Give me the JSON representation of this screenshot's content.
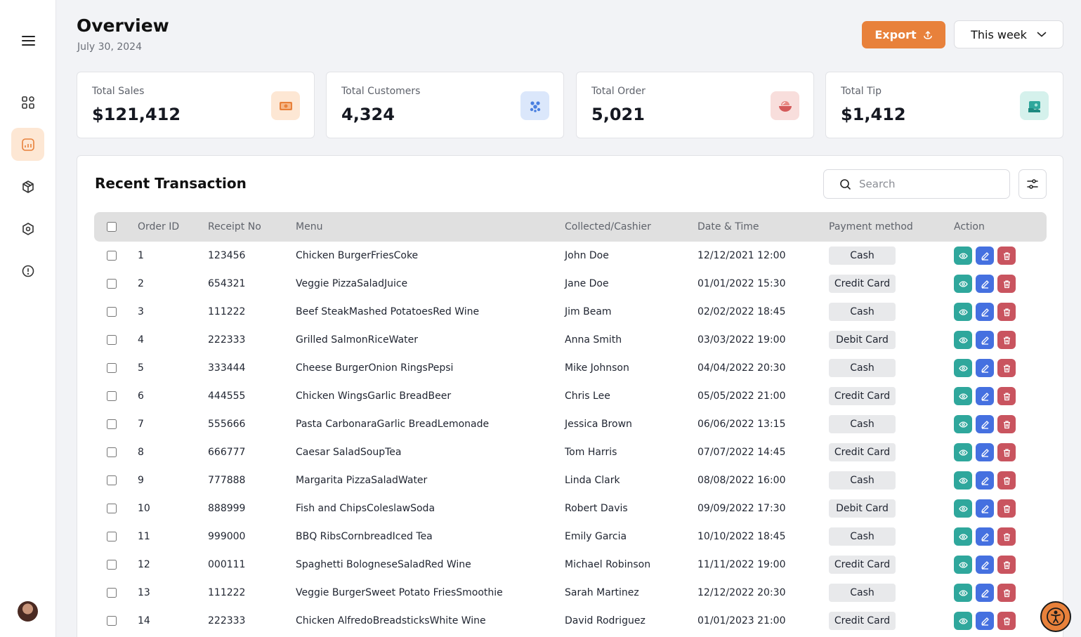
{
  "header": {
    "title": "Overview",
    "date": "July 30, 2024",
    "export_label": "Export",
    "period_label": "This week"
  },
  "sidebar": {
    "items": [
      {
        "name": "dashboard-icon"
      },
      {
        "name": "report-icon",
        "active": true
      },
      {
        "name": "package-icon"
      },
      {
        "name": "settings-icon"
      },
      {
        "name": "info-icon"
      }
    ]
  },
  "stats": [
    {
      "label": "Total Sales",
      "value": "$121,412",
      "icon": "money-icon",
      "color": "#e8813b"
    },
    {
      "label": "Total Customers",
      "value": "4,324",
      "icon": "users-icon",
      "color": "#4a7fe0"
    },
    {
      "label": "Total Order",
      "value": "5,021",
      "icon": "bowl-icon",
      "color": "#d45a5a"
    },
    {
      "label": "Total Tip",
      "value": "$1,412",
      "icon": "tip-icon",
      "color": "#2fa79c"
    }
  ],
  "transactions": {
    "title": "Recent Transaction",
    "search_placeholder": "Search",
    "columns": [
      "Order ID",
      "Receipt No",
      "Menu",
      "Collected/Cashier",
      "Date & Time",
      "Payment method",
      "Action"
    ],
    "rows": [
      {
        "id": "1",
        "receipt": "123456",
        "menu": "Chicken BurgerFriesCoke",
        "cashier": "John Doe",
        "datetime": "12/12/2021 12:00",
        "payment": "Cash"
      },
      {
        "id": "2",
        "receipt": "654321",
        "menu": "Veggie PizzaSaladJuice",
        "cashier": "Jane Doe",
        "datetime": "01/01/2022 15:30",
        "payment": "Credit Card"
      },
      {
        "id": "3",
        "receipt": "111222",
        "menu": "Beef SteakMashed PotatoesRed Wine",
        "cashier": "Jim Beam",
        "datetime": "02/02/2022 18:45",
        "payment": "Cash"
      },
      {
        "id": "4",
        "receipt": "222333",
        "menu": "Grilled SalmonRiceWater",
        "cashier": "Anna Smith",
        "datetime": "03/03/2022 19:00",
        "payment": "Debit Card"
      },
      {
        "id": "5",
        "receipt": "333444",
        "menu": "Cheese BurgerOnion RingsPepsi",
        "cashier": "Mike Johnson",
        "datetime": "04/04/2022 20:30",
        "payment": "Cash"
      },
      {
        "id": "6",
        "receipt": "444555",
        "menu": "Chicken WingsGarlic BreadBeer",
        "cashier": "Chris Lee",
        "datetime": "05/05/2022 21:00",
        "payment": "Credit Card"
      },
      {
        "id": "7",
        "receipt": "555666",
        "menu": "Pasta CarbonaraGarlic BreadLemonade",
        "cashier": "Jessica Brown",
        "datetime": "06/06/2022 13:15",
        "payment": "Cash"
      },
      {
        "id": "8",
        "receipt": "666777",
        "menu": "Caesar SaladSoupTea",
        "cashier": "Tom Harris",
        "datetime": "07/07/2022 14:45",
        "payment": "Credit Card"
      },
      {
        "id": "9",
        "receipt": "777888",
        "menu": "Margarita PizzaSaladWater",
        "cashier": "Linda Clark",
        "datetime": "08/08/2022 16:00",
        "payment": "Cash"
      },
      {
        "id": "10",
        "receipt": "888999",
        "menu": "Fish and ChipsColeslawSoda",
        "cashier": "Robert Davis",
        "datetime": "09/09/2022 17:30",
        "payment": "Debit Card"
      },
      {
        "id": "11",
        "receipt": "999000",
        "menu": "BBQ RibsCornbreadIced Tea",
        "cashier": "Emily Garcia",
        "datetime": "10/10/2022 18:45",
        "payment": "Cash"
      },
      {
        "id": "12",
        "receipt": "000111",
        "menu": "Spaghetti BologneseSaladRed Wine",
        "cashier": "Michael Robinson",
        "datetime": "11/11/2022 19:00",
        "payment": "Credit Card"
      },
      {
        "id": "13",
        "receipt": "111222",
        "menu": "Veggie BurgerSweet Potato FriesSmoothie",
        "cashier": "Sarah Martinez",
        "datetime": "12/12/2022 20:30",
        "payment": "Cash"
      },
      {
        "id": "14",
        "receipt": "222333",
        "menu": "Chicken AlfredoBreadsticksWhite Wine",
        "cashier": "David Rodriguez",
        "datetime": "01/01/2023 21:00",
        "payment": "Credit Card"
      }
    ]
  }
}
